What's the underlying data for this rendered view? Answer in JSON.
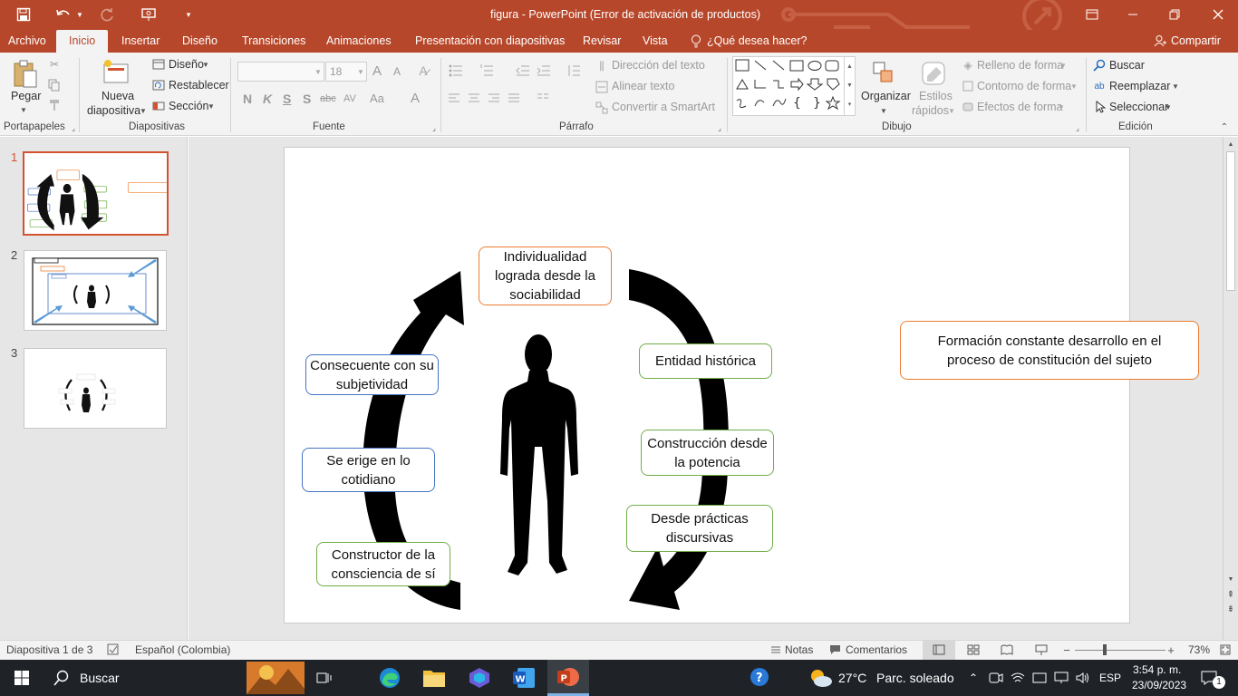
{
  "title_bar": {
    "title": "figura - PowerPoint (Error de activación de productos)",
    "controls": {
      "save": "save-icon",
      "undo": "undo-icon",
      "redo": "redo-icon",
      "present": "present-icon",
      "customize": "customize-icon"
    }
  },
  "tabs": [
    "Archivo",
    "Inicio",
    "Insertar",
    "Diseño",
    "Transiciones",
    "Animaciones",
    "Presentación con diapositivas",
    "Revisar",
    "Vista"
  ],
  "active_tab": "Inicio",
  "tell_me": "¿Qué desea hacer?",
  "share": "Compartir",
  "ribbon": {
    "portapapeles": {
      "paste": "Pegar",
      "label": "Portapapeles"
    },
    "diapositivas": {
      "new_slide_1": "Nueva",
      "new_slide_2": "diapositiva",
      "layout": "Diseño",
      "reset": "Restablecer",
      "section": "Sección",
      "label": "Diapositivas"
    },
    "fuente": {
      "font_name": "",
      "font_size": "18",
      "label": "Fuente",
      "bold": "N",
      "italic": "K",
      "underline": "S",
      "shadow": "S",
      "strike": "abc",
      "spacing": "AV",
      "case": "Aa",
      "grow": "A",
      "shrink": "A",
      "color": "A"
    },
    "parrafo": {
      "text_direction": "Dirección del texto",
      "align_text": "Alinear texto",
      "smartart": "Convertir a SmartArt",
      "label": "Párrafo"
    },
    "dibujo": {
      "arrange": "Organizar",
      "styles_1": "Estilos",
      "styles_2": "rápidos",
      "fill": "Relleno de forma",
      "outline": "Contorno de forma",
      "effects": "Efectos de forma",
      "label": "Dibujo"
    },
    "edicion": {
      "find": "Buscar",
      "replace": "Reemplazar",
      "select": "Seleccionar",
      "label": "Edición"
    }
  },
  "slides": [
    {
      "number": "1"
    },
    {
      "number": "2"
    },
    {
      "number": "3"
    }
  ],
  "slide": {
    "top": "Individualidad lograda desde la sociabilidad",
    "left": [
      "Consecuente con su subjetividad",
      "Se erige en lo cotidiano",
      "Constructor de la consciencia de sí"
    ],
    "right": [
      "Entidad histórica",
      "Construcción desde la potencia",
      "Desde prácticas discursivas"
    ],
    "side_note": "Formación constante desarrollo en el proceso de constitución del sujeto"
  },
  "status": {
    "slide_of": "Diapositiva 1 de 3",
    "language": "Español (Colombia)",
    "notes": "Notas",
    "comments": "Comentarios",
    "zoom": "73%"
  },
  "taskbar": {
    "search": "Buscar",
    "weather_temp": "27°C",
    "weather_text": "Parc. soleado",
    "lang": "ESP",
    "time": "3:54 p. m.",
    "date": "23/09/2023",
    "notifications": "1"
  },
  "colors": {
    "accent": "#b7472a",
    "orange": "#ed7d31",
    "green": "#70ad47",
    "blue": "#4472c4"
  }
}
